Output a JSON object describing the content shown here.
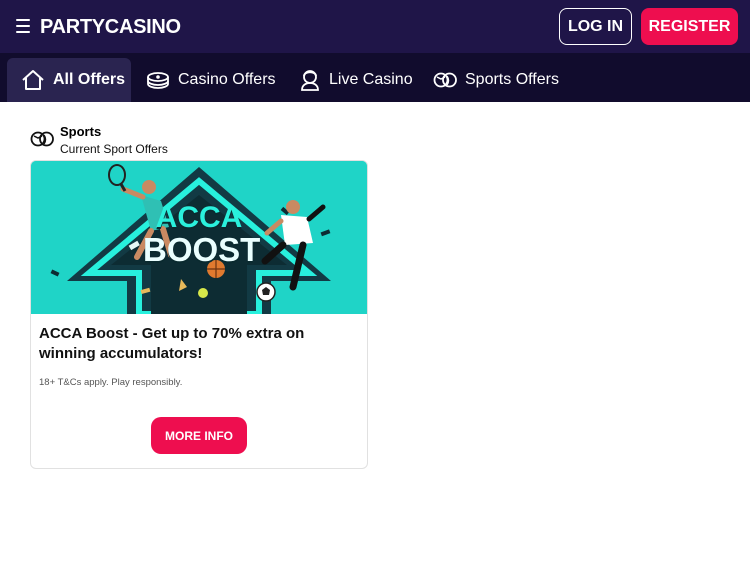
{
  "header": {
    "logo_text": "PARTYCASINO",
    "login_label": "LOG IN",
    "register_label": "REGISTER",
    "bg_color": "#1f1548",
    "accent_color": "#ee0e4f"
  },
  "nav": {
    "tabs": [
      {
        "label": "All Offers",
        "icon": "home-icon",
        "active": true
      },
      {
        "label": "Casino Offers",
        "icon": "casino-chips-icon",
        "active": false
      },
      {
        "label": "Live Casino",
        "icon": "dealer-icon",
        "active": false
      },
      {
        "label": "Sports Offers",
        "icon": "sports-balls-icon",
        "active": false
      }
    ]
  },
  "section": {
    "title": "Sports",
    "subtitle": "Current Sport Offers",
    "icon": "sports-balls-icon"
  },
  "card": {
    "banner_text_line1": "ACCA",
    "banner_text_line2": "BOOST",
    "title": "ACCA Boost - Get up to 70% extra on winning accumulators!",
    "terms": "18+ T&Cs apply. Play responsibly.",
    "button_label": "MORE INFO"
  }
}
